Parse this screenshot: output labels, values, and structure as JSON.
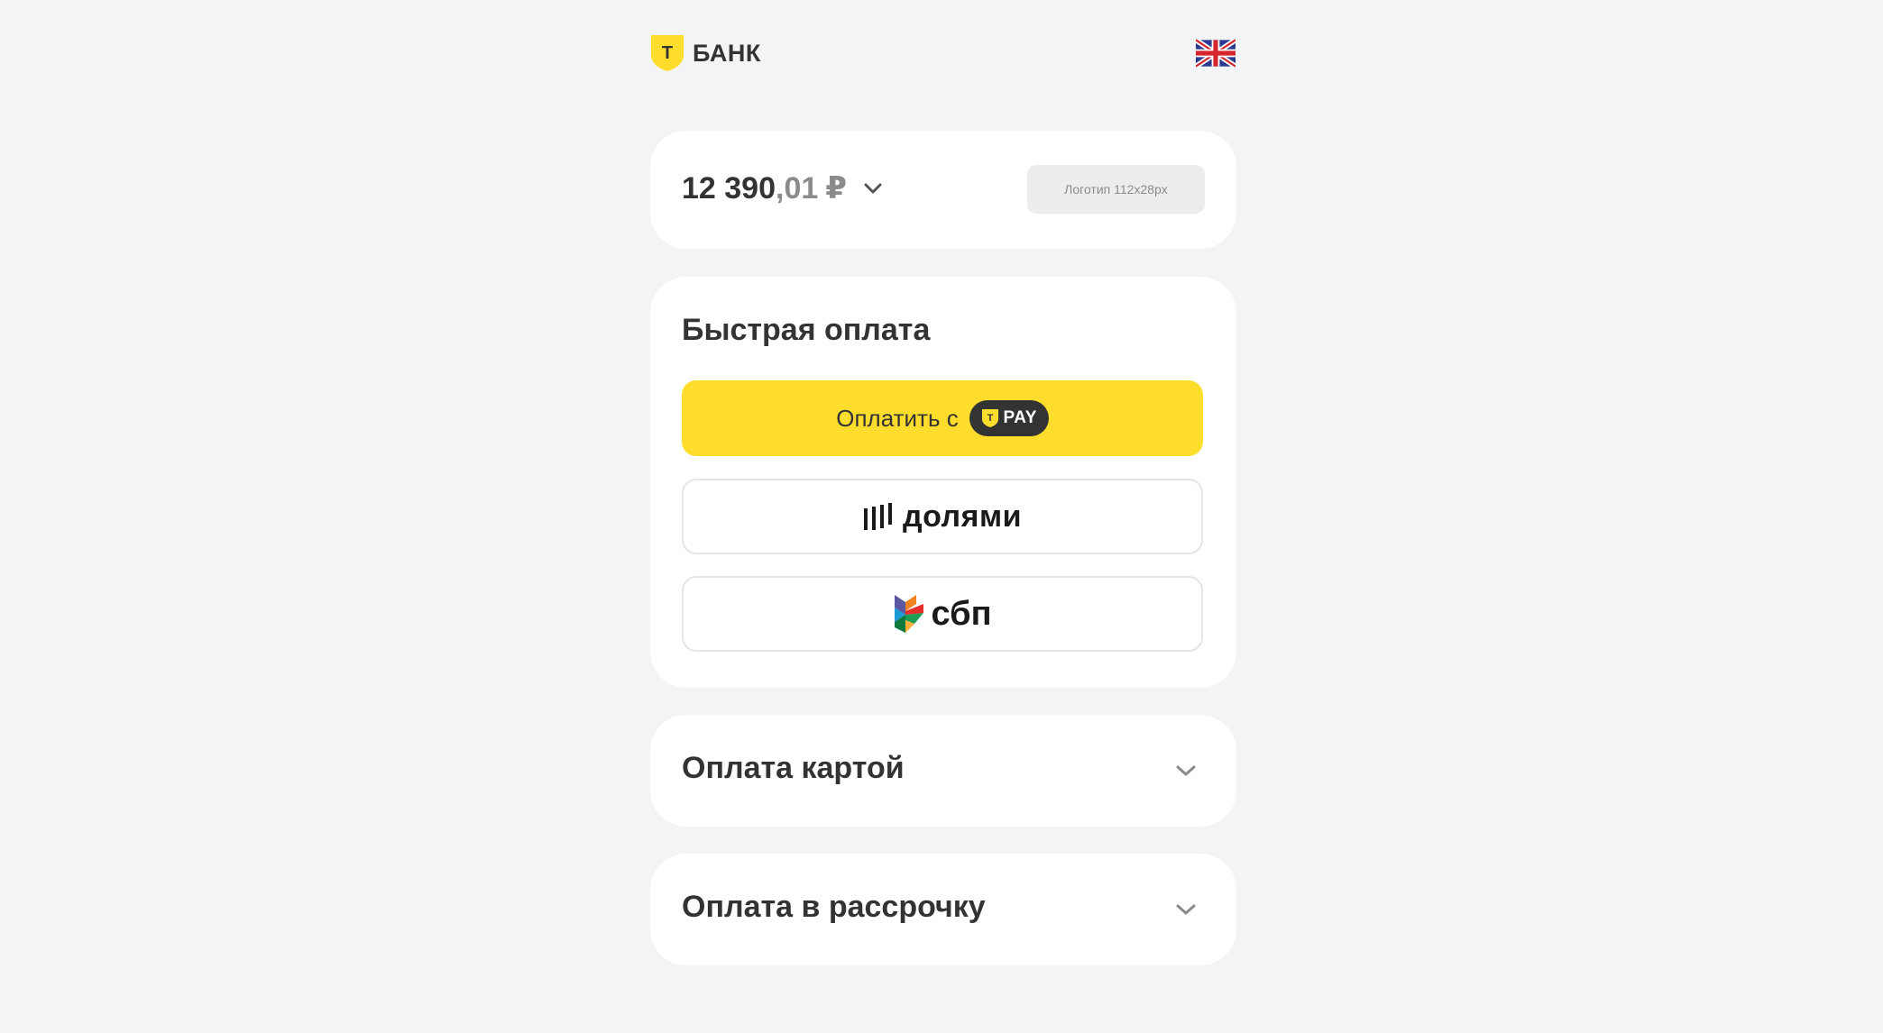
{
  "header": {
    "brand_letter": "Т",
    "brand_name": "БАНК",
    "language_flag": "uk-flag-icon"
  },
  "amount": {
    "rubles": "12 390",
    "kopecks": ",01",
    "currency": "₽",
    "logo_placeholder": "Логотип 112x28px"
  },
  "quick_pay": {
    "title": "Быстрая оплата",
    "tpay_label": "Оплатить с",
    "tpay_badge_letter": "Т",
    "tpay_badge": "PAY",
    "dolyami_label": "долями",
    "sbp_label": "сбп"
  },
  "sections": {
    "card_payment": "Оплата картой",
    "installment": "Оплата в рассрочку"
  },
  "colors": {
    "accent": "#ffdd2d",
    "background": "#f3f4f6",
    "text": "#333333"
  }
}
